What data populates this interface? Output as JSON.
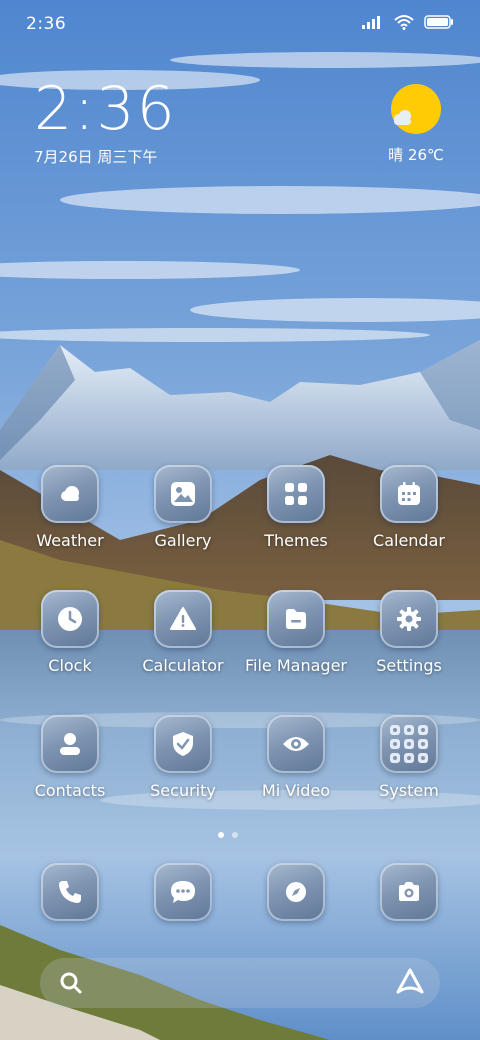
{
  "status_bar": {
    "time": "2:36"
  },
  "clock_widget": {
    "time": "2:36",
    "date": "7月26日 周三下午"
  },
  "weather_widget": {
    "icon": "sun-with-cloud-icon",
    "text": "晴 26℃"
  },
  "apps": [
    {
      "label": "Weather",
      "icon": "weather-cloud-icon"
    },
    {
      "label": "Gallery",
      "icon": "gallery-icon"
    },
    {
      "label": "Themes",
      "icon": "themes-grid-icon"
    },
    {
      "label": "Calendar",
      "icon": "calendar-icon"
    },
    {
      "label": "Clock",
      "icon": "clock-icon"
    },
    {
      "label": "Calculator",
      "icon": "calculator-icon"
    },
    {
      "label": "File Manager",
      "icon": "folder-icon"
    },
    {
      "label": "Settings",
      "icon": "gear-icon"
    },
    {
      "label": "Contacts",
      "icon": "contacts-person-icon"
    },
    {
      "label": "Security",
      "icon": "shield-check-icon"
    },
    {
      "label": "Mi Video",
      "icon": "eye-icon"
    },
    {
      "label": "System",
      "icon": "folder-grid-icon"
    }
  ],
  "dock": [
    {
      "name": "phone",
      "icon": "phone-icon"
    },
    {
      "name": "messages",
      "icon": "chat-bubble-icon"
    },
    {
      "name": "browser",
      "icon": "compass-icon"
    },
    {
      "name": "camera",
      "icon": "camera-icon"
    }
  ],
  "page_indicator": {
    "pages": 2,
    "current": 1
  },
  "colors": {
    "sun": "#FFCB05",
    "icon_tile": "#7F95B2",
    "sky": "#6E9BD8"
  }
}
